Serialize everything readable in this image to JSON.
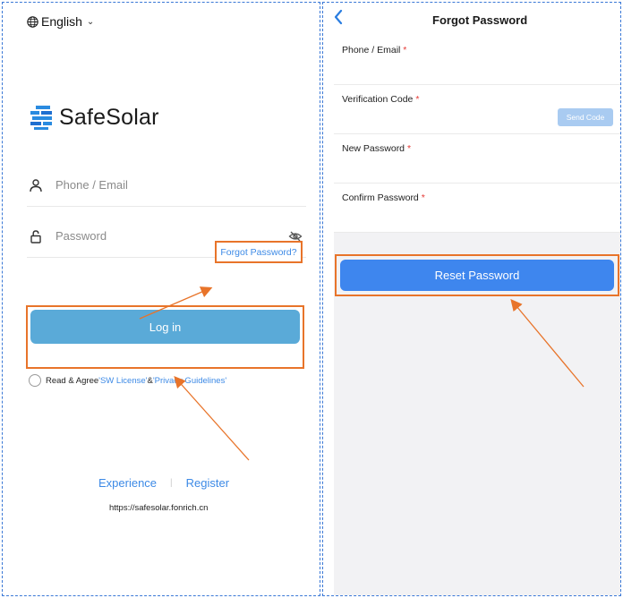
{
  "left_panel": {
    "language": "English",
    "brand": "SafeSolar",
    "phone_placeholder": "Phone / Email",
    "password_placeholder": "Password",
    "forgot_password": "Forgot Password?",
    "login_label": "Log in",
    "agree": {
      "prefix": "Read & Agree ",
      "license": "'SW License'",
      "ampersand": "&",
      "privacy": "'Privacy Guidelines'"
    },
    "experience": "Experience",
    "register": "Register",
    "url": "https://safesolar.fonrich.cn"
  },
  "right_panel": {
    "title": "Forgot Password",
    "fields": [
      {
        "label": "Phone / Email",
        "required": "*"
      },
      {
        "label": "Verification Code",
        "required": "*"
      },
      {
        "label": "New Password",
        "required": "*"
      },
      {
        "label": "Confirm Password",
        "required": "*"
      }
    ],
    "send_code": "Send Code",
    "reset_label": "Reset Password"
  },
  "colors": {
    "link_blue": "#3d8ae6",
    "login_button": "#5aaad8",
    "reset_button": "#3e86ee",
    "highlight_orange": "#e8742a",
    "required_red": "#e53935"
  }
}
